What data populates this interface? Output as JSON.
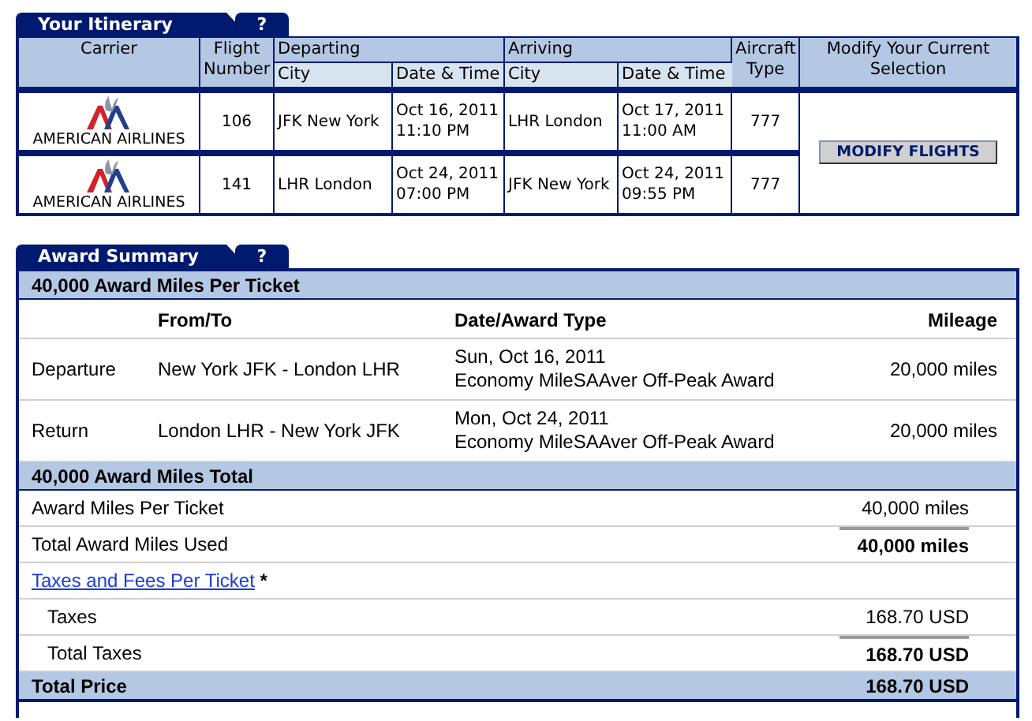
{
  "itinerary": {
    "title": "Your Itinerary",
    "help": "?",
    "headers": {
      "carrier": "Carrier",
      "flight": "Flight Number",
      "departing": "Departing",
      "arriving": "Arriving",
      "dep_city": "City",
      "dep_datetime": "Date & Time",
      "arr_city": "City",
      "arr_datetime": "Date & Time",
      "aircraft": "Aircraft Type",
      "modify": "Modify Your Current Selection"
    },
    "rows": [
      {
        "carrier": "AMERICAN AIRLINES",
        "flight": "106",
        "dep_city": "JFK New York",
        "dep_date": "Oct 16, 2011",
        "dep_time": "11:10 PM",
        "arr_city": "LHR London",
        "arr_date": "Oct 17, 2011",
        "arr_time": "11:00 AM",
        "aircraft": "777"
      },
      {
        "carrier": "AMERICAN AIRLINES",
        "flight": "141",
        "dep_city": "LHR London",
        "dep_date": "Oct 24, 2011",
        "dep_time": "07:00 PM",
        "arr_city": "JFK New York",
        "arr_date": "Oct 24, 2011",
        "arr_time": "09:55 PM",
        "aircraft": "777"
      }
    ],
    "button": "MODIFY FLIGHTS"
  },
  "award_summary": {
    "title": "Award Summary",
    "help": "?",
    "heading": "40,000 Award Miles Per Ticket",
    "columns": [
      "From/To",
      "Date/Award Type",
      "Mileage"
    ],
    "segments": [
      {
        "label": "Departure",
        "route": "New York JFK - London LHR",
        "date": "Sun, Oct 16, 2011",
        "award_type": "Economy MileSAAver Off-Peak Award",
        "mileage": "20,000 miles"
      },
      {
        "label": "Return",
        "route": "London LHR - New York JFK",
        "date": "Mon, Oct 24, 2011",
        "award_type": "Economy MileSAAver Off-Peak Award",
        "mileage": "20,000 miles"
      }
    ],
    "totals_heading": "40,000 Award Miles Total",
    "lines": [
      {
        "kind": "line",
        "label": "Award Miles Per Ticket",
        "value": "40,000 miles"
      },
      {
        "kind": "total",
        "label": "Total Award Miles Used",
        "value": "40,000 miles"
      },
      {
        "kind": "link",
        "label": "Taxes and Fees Per Ticket",
        "note": "*"
      },
      {
        "kind": "sub",
        "label": "Taxes",
        "value": "168.70 USD"
      },
      {
        "kind": "subtotal",
        "label": "Total Taxes",
        "value": "168.70 USD"
      },
      {
        "kind": "grand",
        "label": "Total Price",
        "value": "168.70 USD"
      }
    ]
  }
}
